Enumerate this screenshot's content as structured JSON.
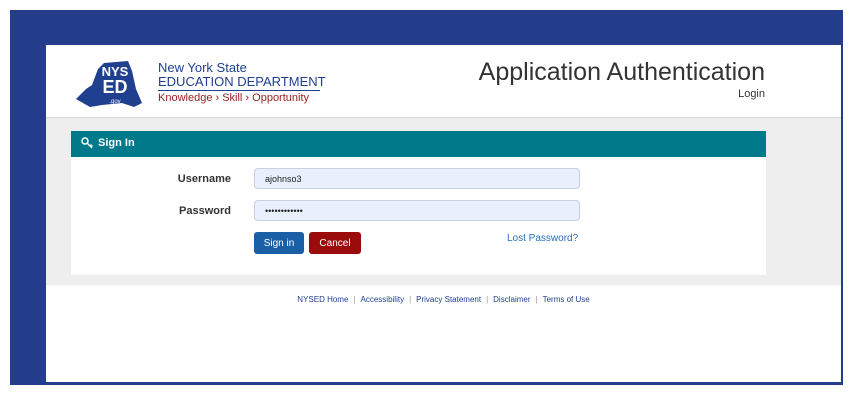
{
  "header": {
    "logo": {
      "badge_top": "NYS",
      "badge_mid": "ED",
      "badge_bottom": ".gov",
      "line1": "New York State",
      "line2": "EDUCATION DEPARTMENT",
      "line3": "Knowledge › Skill › Opportunity"
    },
    "title": "Application Authentication",
    "subtitle": "Login"
  },
  "signin": {
    "heading": "Sign In",
    "icon": "key-icon",
    "username_label": "Username",
    "username_value": "ajohnso3",
    "password_label": "Password",
    "password_value": "••••••••••••",
    "signin_button": "Sign in",
    "cancel_button": "Cancel",
    "lost_password": "Lost Password?"
  },
  "footer": {
    "links": [
      "NYSED Home",
      "Accessibility",
      "Privacy Statement",
      "Disclaimer",
      "Terms of Use"
    ]
  },
  "colors": {
    "frame": "#233d8b",
    "teal_bar": "#00798a",
    "signin_btn": "#1a5fa6",
    "cancel_btn": "#9b0b0b"
  }
}
